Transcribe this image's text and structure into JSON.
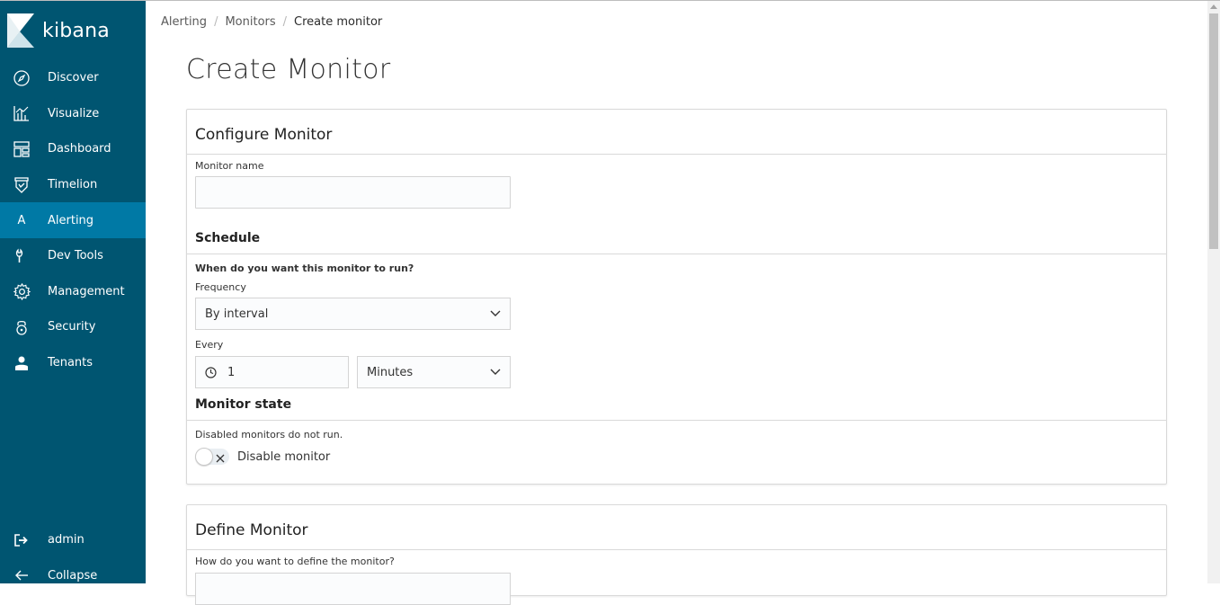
{
  "app": {
    "logo_text": "kibana"
  },
  "sidebar": {
    "items": [
      {
        "label": "Discover",
        "icon": "compass-icon",
        "active": false
      },
      {
        "label": "Visualize",
        "icon": "bar-chart-icon",
        "active": false
      },
      {
        "label": "Dashboard",
        "icon": "dashboard-icon",
        "active": false
      },
      {
        "label": "Timelion",
        "icon": "timelion-shield-icon",
        "active": false
      },
      {
        "label": "Alerting",
        "icon": "letter-a-icon",
        "icon_letter": "A",
        "active": true
      },
      {
        "label": "Dev Tools",
        "icon": "wrench-icon",
        "active": false
      },
      {
        "label": "Management",
        "icon": "gear-icon",
        "active": false
      },
      {
        "label": "Security",
        "icon": "lock-icon",
        "active": false
      },
      {
        "label": "Tenants",
        "icon": "user-icon",
        "active": false
      }
    ],
    "bottom": [
      {
        "label": "admin",
        "icon": "logout-icon"
      },
      {
        "label": "Collapse",
        "icon": "arrow-left-icon"
      }
    ]
  },
  "breadcrumbs": [
    "Alerting",
    "Monitors",
    "Create monitor"
  ],
  "page_title": "Create Monitor",
  "configure": {
    "title": "Configure Monitor",
    "monitor_name_label": "Monitor name",
    "monitor_name_value": "",
    "schedule_title": "Schedule",
    "schedule_question": "When do you want this monitor to run?",
    "frequency_label": "Frequency",
    "frequency_value": "By interval",
    "every_label": "Every",
    "every_value": "1",
    "every_unit": "Minutes",
    "state_title": "Monitor state",
    "state_help": "Disabled monitors do not run.",
    "toggle_label": "Disable monitor",
    "toggle_on": false
  },
  "define": {
    "title": "Define Monitor",
    "question": "How do you want to define the monitor?"
  },
  "colors": {
    "sidebar_bg": "#005571",
    "sidebar_active": "#0079a5",
    "logo_accent": "#f3c94a"
  }
}
